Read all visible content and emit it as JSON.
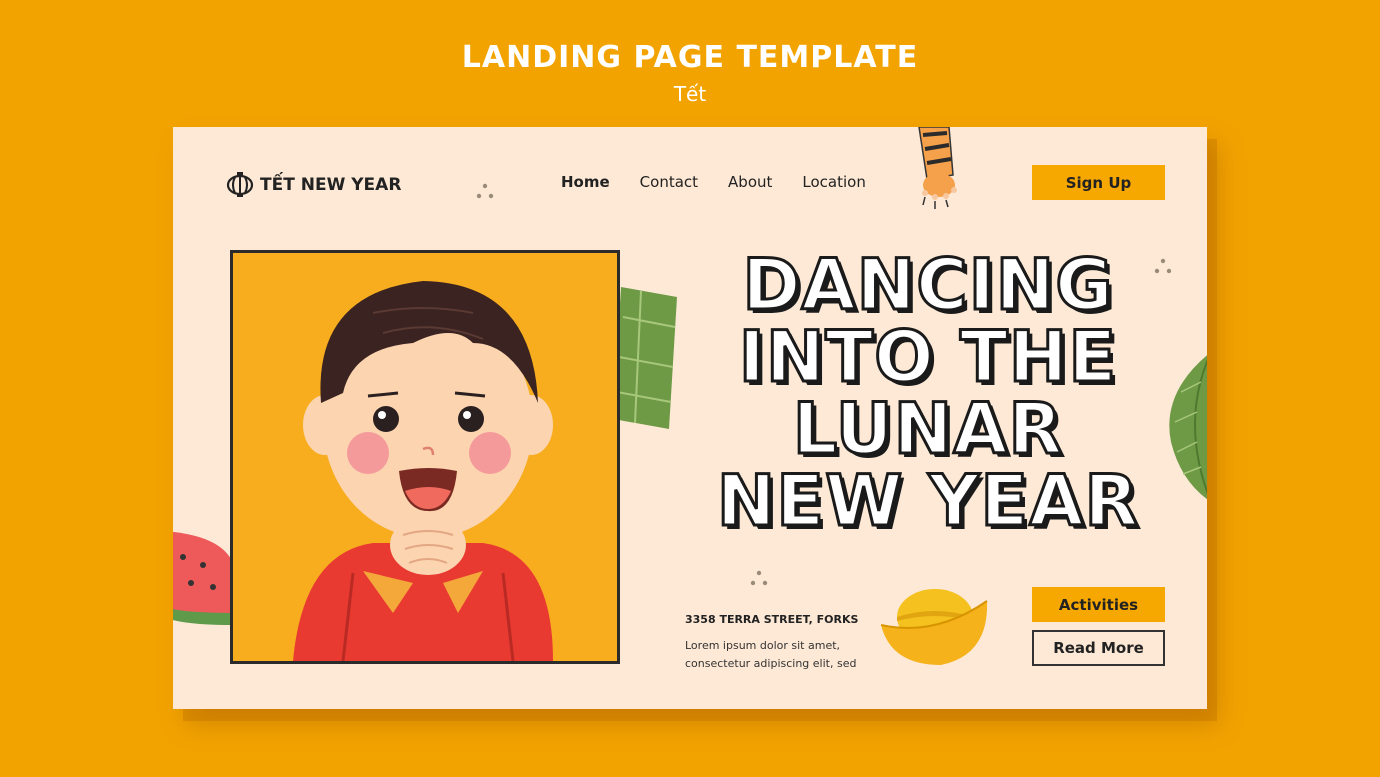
{
  "header": {
    "title": "LANDING PAGE TEMPLATE",
    "subtitle": "Tết"
  },
  "brand": {
    "name": "TẾT NEW YEAR",
    "icon": "lantern-icon"
  },
  "nav": {
    "items": [
      "Home",
      "Contact",
      "About",
      "Location"
    ],
    "active": "Home"
  },
  "buttons": {
    "signup": "Sign Up",
    "activities": "Activities",
    "read_more": "Read More"
  },
  "hero": {
    "lines": [
      "DANCING",
      "INTO THE",
      "LUNAR",
      "NEW YEAR"
    ]
  },
  "info": {
    "address": "3358 TERRA STREET, FORKS",
    "description_line1": "Lorem ipsum dolor sit amet,",
    "description_line2": "consectetur adipiscing elit, sed"
  },
  "colors": {
    "background": "#F3A300",
    "card": "#FDE9D6",
    "accent": "#F7A800",
    "text": "#222222"
  }
}
